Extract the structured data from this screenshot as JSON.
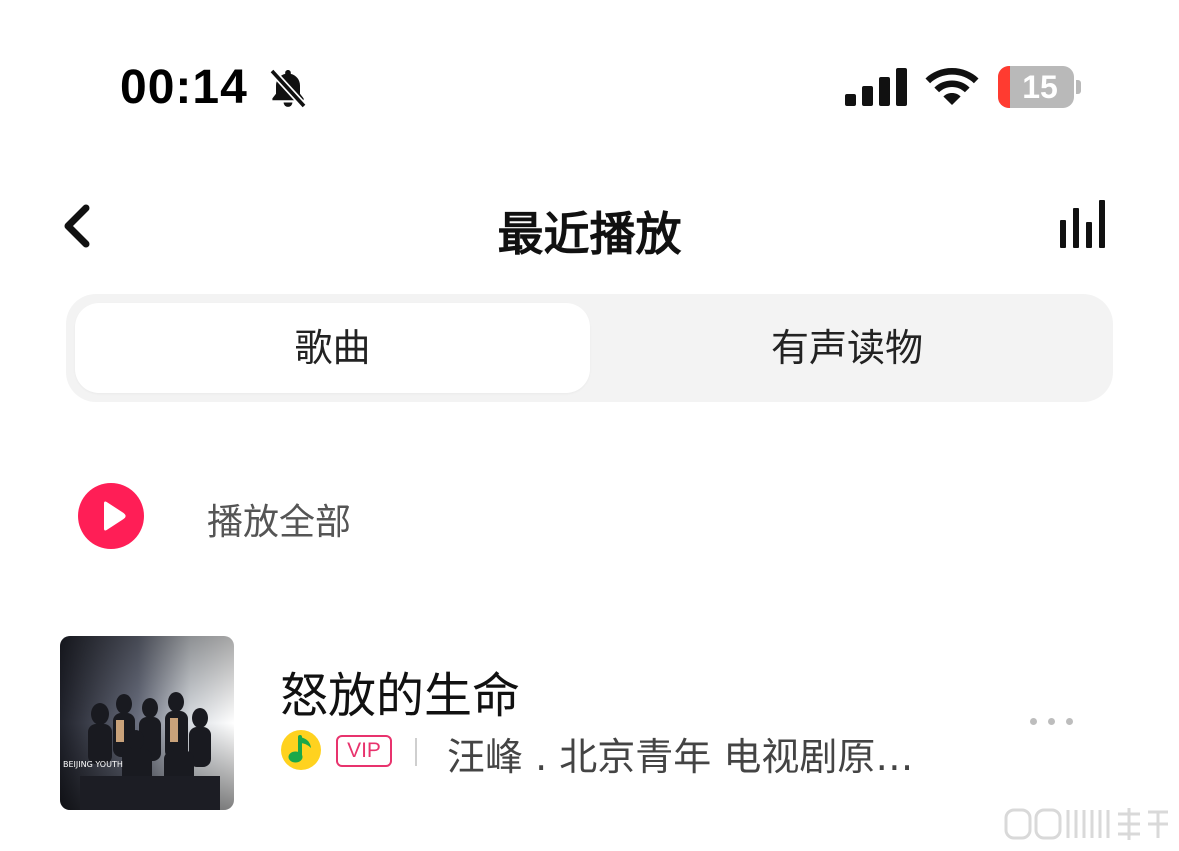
{
  "status_bar": {
    "time": "00:14",
    "battery_level": "15",
    "icons": [
      "bell-slash-icon",
      "cellular-signal-icon",
      "wifi-icon",
      "battery-icon"
    ]
  },
  "nav": {
    "title": "最近播放",
    "back_icon": "chevron-left-icon",
    "right_icon": "equalizer-icon"
  },
  "tabs": [
    {
      "label": "歌曲",
      "selected": true
    },
    {
      "label": "有声读物",
      "selected": false
    }
  ],
  "play_all": {
    "label": "播放全部",
    "icon": "play-icon"
  },
  "songs": [
    {
      "title": "怒放的生命",
      "badge": "VIP",
      "meta": "汪峰 . 北京青年 电视剧原…",
      "cover_text": "BEIJING YOUTH 北京青年"
    }
  ],
  "colors": {
    "accent": "#ff1e56",
    "vip": "#e8336d",
    "battery_low": "#ff3b30",
    "segment_bg": "#f3f3f3"
  }
}
